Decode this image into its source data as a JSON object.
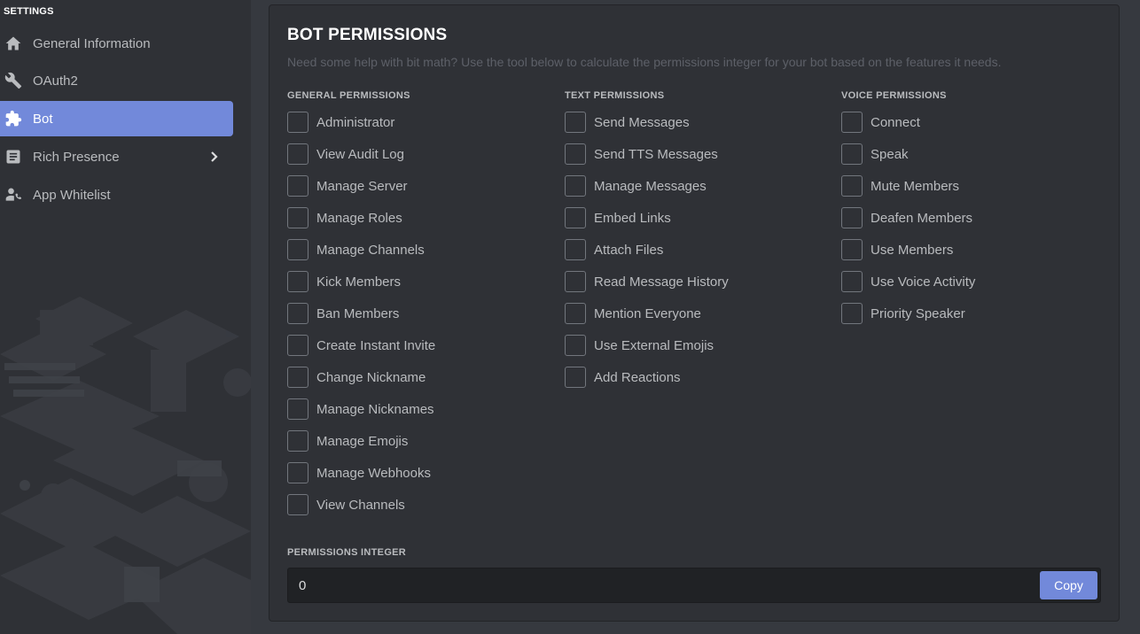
{
  "sidebar": {
    "heading": "SETTINGS",
    "items": [
      {
        "label": "General Information",
        "icon": "home-icon"
      },
      {
        "label": "OAuth2",
        "icon": "wrench-icon"
      },
      {
        "label": "Bot",
        "icon": "puzzle-icon",
        "active": true
      },
      {
        "label": "Rich Presence",
        "icon": "document-icon",
        "expandable": true
      },
      {
        "label": "App Whitelist",
        "icon": "user-phone-icon"
      }
    ]
  },
  "panel": {
    "title": "BOT PERMISSIONS",
    "description": "Need some help with bit math? Use the tool below to calculate the permissions integer for your bot based on the features it needs.",
    "columns": [
      {
        "heading": "GENERAL PERMISSIONS",
        "permissions": [
          "Administrator",
          "View Audit Log",
          "Manage Server",
          "Manage Roles",
          "Manage Channels",
          "Kick Members",
          "Ban Members",
          "Create Instant Invite",
          "Change Nickname",
          "Manage Nicknames",
          "Manage Emojis",
          "Manage Webhooks",
          "View Channels"
        ]
      },
      {
        "heading": "TEXT PERMISSIONS",
        "permissions": [
          "Send Messages",
          "Send TTS Messages",
          "Manage Messages",
          "Embed Links",
          "Attach Files",
          "Read Message History",
          "Mention Everyone",
          "Use External Emojis",
          "Add Reactions"
        ]
      },
      {
        "heading": "VOICE PERMISSIONS",
        "permissions": [
          "Connect",
          "Speak",
          "Mute Members",
          "Deafen Members",
          "Use Members",
          "Use Voice Activity",
          "Priority Speaker"
        ]
      }
    ],
    "integer_heading": "PERMISSIONS INTEGER",
    "integer_value": "0",
    "copy_label": "Copy"
  },
  "colors": {
    "accent": "#7289da",
    "background": "#36393f",
    "sidebar": "#2f3136",
    "input": "#202225"
  }
}
